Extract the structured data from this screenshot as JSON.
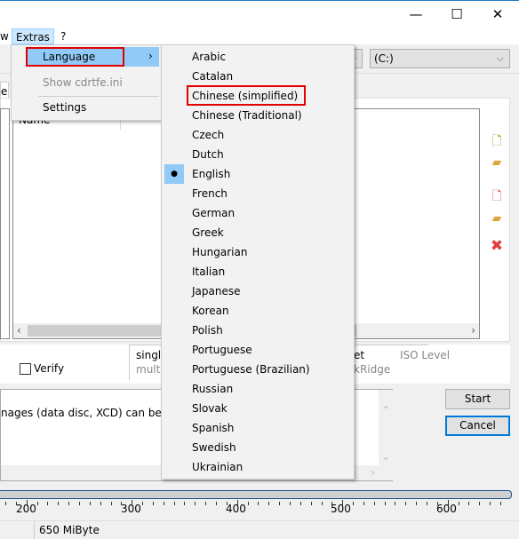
{
  "window": {
    "controls": {
      "minimize": "—",
      "maximize": "☐",
      "close": "✕"
    }
  },
  "menubar": {
    "items": [
      {
        "label": "w"
      },
      {
        "label": "Extras"
      },
      {
        "label": "?"
      }
    ]
  },
  "toolbar": {
    "drive_combo": "(C:)"
  },
  "tab_fragment": "e",
  "file_list": {
    "column": "Name"
  },
  "side_icons": [
    "add-file-icon",
    "add-folder-icon",
    "remove-file-icon",
    "remove-folder-icon",
    "delete-icon"
  ],
  "options": {
    "verify_label": "Verify",
    "verify_checked": false,
    "session_single": "single",
    "session_multi": "multi",
    "fragment_et": "et",
    "iso_level": "ISO Level",
    "rockridge_fragment": "kRidge"
  },
  "log": {
    "text": "nages (data disc, XCD) can be crea"
  },
  "buttons": {
    "start": "Start",
    "cancel": "Cancel"
  },
  "ruler": {
    "labels": [
      "200",
      "300",
      "400",
      "500",
      "600"
    ]
  },
  "status": {
    "size": "650 MiByte"
  },
  "extras_menu": {
    "items": [
      {
        "label": "Language",
        "highlighted": true,
        "submenu": true
      },
      {
        "label": "Show cdrtfe.ini",
        "disabled": true
      },
      {
        "label": "Settings"
      }
    ],
    "submenu_arrow": "›"
  },
  "language_menu": {
    "selected": "English",
    "bullet": "●",
    "items": [
      "Arabic",
      "Catalan",
      "Chinese (simplified)",
      "Chinese (Traditional)",
      "Czech",
      "Dutch",
      "English",
      "French",
      "German",
      "Greek",
      "Hungarian",
      "Italian",
      "Japanese",
      "Korean",
      "Polish",
      "Portuguese",
      "Portuguese (Brazilian)",
      "Russian",
      "Slovak",
      "Spanish",
      "Swedish",
      "Ukrainian"
    ]
  },
  "colors": {
    "highlight": "#91c9f7",
    "menu_active": "#cce8ff",
    "annotation": "#e00000",
    "focus": "#0078d7"
  }
}
